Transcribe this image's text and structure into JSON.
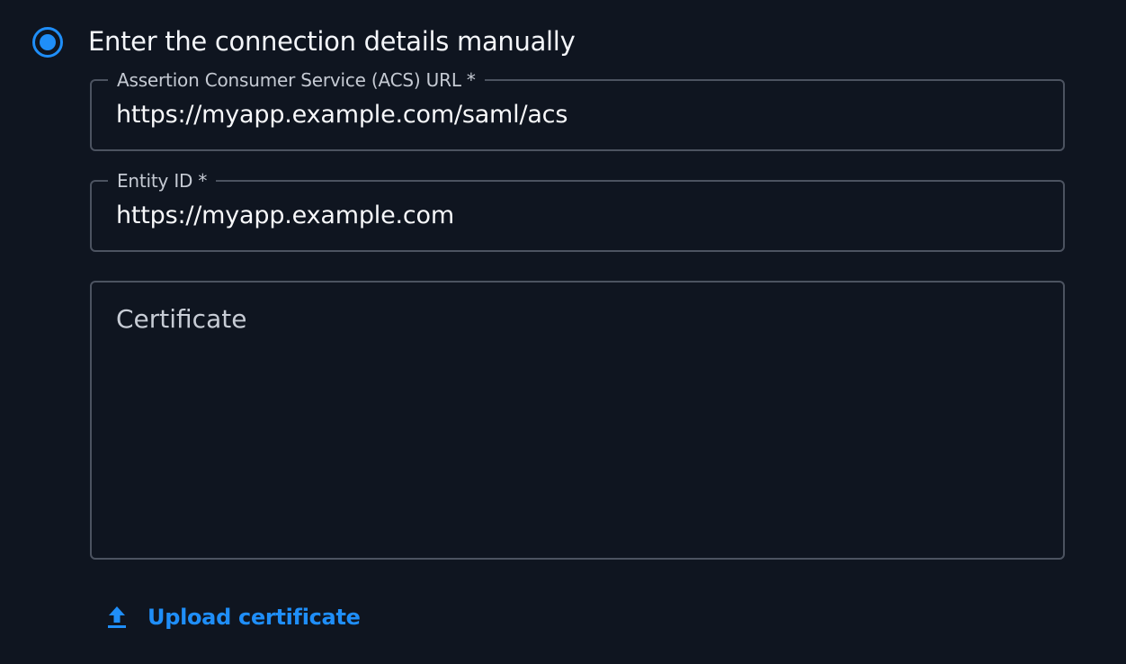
{
  "colors": {
    "background": "#0f1520",
    "accent": "#1f8ef8",
    "field_border": "#4c5360",
    "text_primary": "#f4f6fa",
    "text_secondary": "#c5cad3"
  },
  "radio_option": {
    "label": "Enter the connection details manually",
    "selected": true
  },
  "fields": {
    "acs_url": {
      "label": "Assertion Consumer Service (ACS) URL *",
      "value": "https://myapp.example.com/saml/acs"
    },
    "entity_id": {
      "label": "Entity ID *",
      "value": "https://myapp.example.com"
    },
    "certificate": {
      "placeholder": "Certificate",
      "value": ""
    }
  },
  "upload": {
    "label": "Upload certificate",
    "icon": "upload-icon"
  }
}
